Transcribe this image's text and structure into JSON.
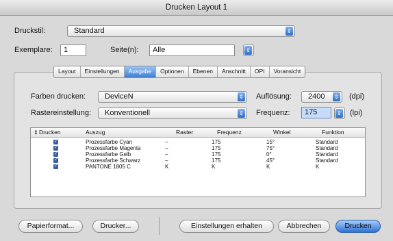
{
  "window": {
    "title": "Drucken Layout 1"
  },
  "druckstil": {
    "label": "Druckstil:",
    "value": "Standard"
  },
  "exemplare": {
    "label": "Exemplare:",
    "value": "1"
  },
  "seiten": {
    "label": "Seite(n):",
    "value": "Alle"
  },
  "tabs": [
    {
      "label": "Layout"
    },
    {
      "label": "Einstellungen"
    },
    {
      "label": "Ausgabe"
    },
    {
      "label": "Optionen"
    },
    {
      "label": "Ebenen"
    },
    {
      "label": "Anschnitt"
    },
    {
      "label": "OPI"
    },
    {
      "label": "Voransicht"
    }
  ],
  "ausgabe": {
    "farben_label": "Farben drucken:",
    "farben_value": "DeviceN",
    "aufloesung_label": "Auflösung:",
    "aufloesung_value": "2400",
    "aufloesung_unit": "(dpi)",
    "raster_label": "Rastereinstellung:",
    "raster_value": "Konventionell",
    "frequenz_label": "Frequenz:",
    "frequenz_value": "175",
    "frequenz_unit": "(lpi)"
  },
  "table": {
    "headers": [
      "Drucken",
      "Auszug",
      "Raster",
      "Frequenz",
      "Winkel",
      "Funktion"
    ],
    "rows": [
      {
        "auszug": "Prozessfarbe Cyan",
        "raster": "–",
        "frequenz": "175",
        "winkel": "15°",
        "funktion": "Standard"
      },
      {
        "auszug": "Prozessfarbe Magenta",
        "raster": "–",
        "frequenz": "175",
        "winkel": "75°",
        "funktion": "Standard"
      },
      {
        "auszug": "Prozessfarbe Gelb",
        "raster": "–",
        "frequenz": "175",
        "winkel": "0°",
        "funktion": "Standard"
      },
      {
        "auszug": "Prozessfarbe Schwarz",
        "raster": "–",
        "frequenz": "175",
        "winkel": "45°",
        "funktion": "Standard"
      },
      {
        "auszug": "PANTONE 1805 C",
        "raster": "K",
        "frequenz": "K",
        "winkel": "K",
        "funktion": "K"
      }
    ]
  },
  "buttons": {
    "papierformat": "Papierformat...",
    "drucker": "Drucker...",
    "einstellungen_erhalten": "Einstellungen erhalten",
    "abbrechen": "Abbrechen",
    "drucken": "Drucken"
  },
  "icons": {
    "popup_arrow": "up-down-arrows-icon",
    "checkbox": "checkmark-icon"
  },
  "colors": {
    "accent": "#3b7fd6",
    "background": "#d9d9d9"
  }
}
